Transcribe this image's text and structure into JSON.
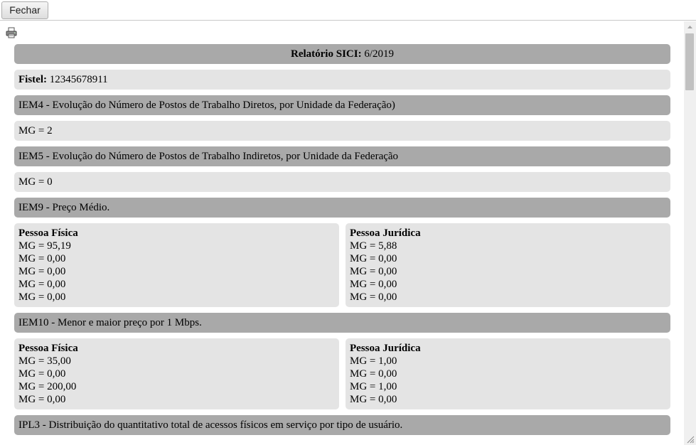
{
  "toolbar": {
    "close_label": "Fechar"
  },
  "icons": {
    "print": "printer-icon"
  },
  "report": {
    "title_label": "Relatório SICI:",
    "title_value": "6/2019",
    "fistel_label": "Fistel:",
    "fistel_value": "12345678911"
  },
  "sections": {
    "iem4": {
      "title": "IEM4 - Evolução do Número de Postos de Trabalho Diretos, por Unidade da Federação)",
      "value": "MG = 2"
    },
    "iem5": {
      "title": "IEM5 - Evolução do Número de Postos de Trabalho Indiretos, por Unidade da Federação",
      "value": "MG = 0"
    },
    "iem9": {
      "title": "IEM9 - Preço Médio.",
      "pf": {
        "heading": "Pessoa Física",
        "lines": [
          "MG = 95,19",
          "MG = 0,00",
          "MG = 0,00",
          "MG = 0,00",
          "MG = 0,00"
        ]
      },
      "pj": {
        "heading": "Pessoa Jurídica",
        "lines": [
          "MG = 5,88",
          "MG = 0,00",
          "MG = 0,00",
          "MG = 0,00",
          "MG = 0,00"
        ]
      }
    },
    "iem10": {
      "title": "IEM10 - Menor e maior preço por 1 Mbps.",
      "pf": {
        "heading": "Pessoa Física",
        "lines": [
          "MG = 35,00",
          "MG = 0,00",
          "MG = 200,00",
          "MG = 0,00"
        ]
      },
      "pj": {
        "heading": "Pessoa Jurídica",
        "lines": [
          "MG = 1,00",
          "MG = 0,00",
          "MG = 1,00",
          "MG = 0,00"
        ]
      }
    },
    "ipl3": {
      "title": "IPL3 - Distribuição do quantitativo total de acessos físicos em serviço por tipo de usuário."
    }
  }
}
